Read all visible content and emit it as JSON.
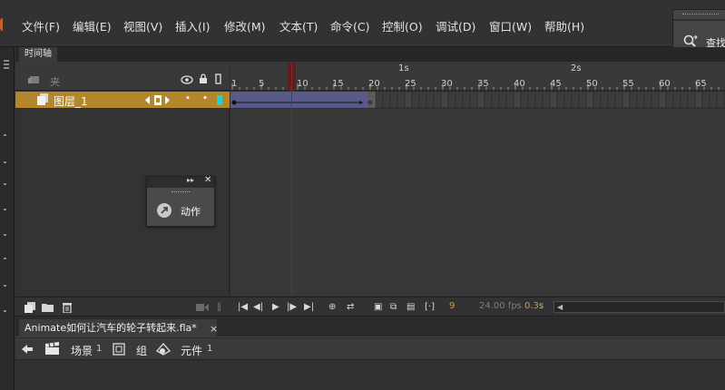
{
  "menu": {
    "items": [
      "文件(F)",
      "编辑(E)",
      "视图(V)",
      "插入(I)",
      "修改(M)",
      "文本(T)",
      "命令(C)",
      "控制(O)",
      "调试(D)",
      "窗口(W)",
      "帮助(H)"
    ]
  },
  "search_panel": {
    "label": "查找"
  },
  "timeline": {
    "tab_label": "时间轴",
    "folder_label": "夹",
    "layer_name": "图层_1",
    "ruler_frames": [
      "1",
      "5",
      "10",
      "15",
      "20",
      "25",
      "30",
      "35",
      "40",
      "45",
      "50",
      "55",
      "60",
      "65"
    ],
    "ruler_seconds": [
      "1s",
      "2s"
    ],
    "current_frame": "9",
    "fps": "24.00 fps",
    "time": "0.3",
    "time_unit": "s"
  },
  "actions_panel": {
    "label": "动作"
  },
  "document": {
    "tab_label": "Animate如何让汽车的轮子转起来.fla*",
    "close_glyph": "×"
  },
  "edit_bar": {
    "scene_label": "场景",
    "scene_num": "1",
    "group_label": "组",
    "symbol_label": "元件",
    "symbol_num": "1"
  },
  "colors": {
    "layer_highlight": "#b5872b",
    "playhead": "#9c1e1e",
    "tween_span": "#5a5a8a",
    "accent_number": "#d39a36"
  }
}
